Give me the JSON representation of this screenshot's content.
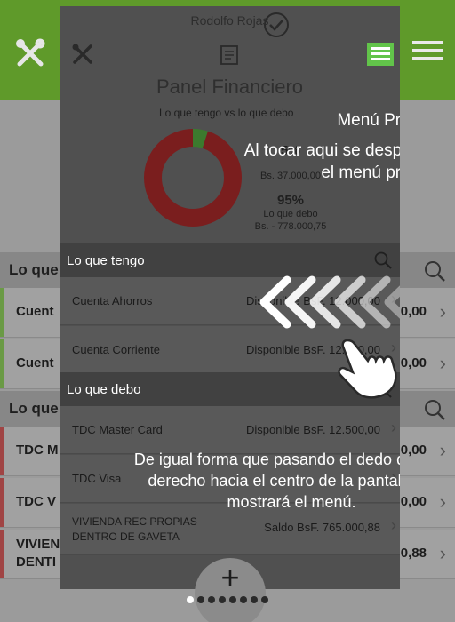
{
  "overlay": {
    "user_name": "Rodolfo Rojas",
    "title": "Panel Financiero",
    "chart_subtitle": "Lo que tengo vs lo que debo",
    "stat1_pct": "5%",
    "stat1_amount": "Bs. 37.000,00",
    "stat2_pct": "95%",
    "stat2_label": "Lo que debo",
    "stat2_amount": "Bs. - 778.000,75",
    "icons": [
      "tools-icon",
      "check-circle-icon",
      "document-icon",
      "menu-icon",
      "search-icon",
      "chevron-right-icon",
      "hand-pointer-icon"
    ],
    "accent_color": "#62c44a",
    "section_tengo": "Lo que tengo",
    "section_debo": "Lo que debo",
    "tengo_rows": [
      {
        "name": "Cuenta Ahorros",
        "avail": "Disponible BsF.  12.000,00"
      },
      {
        "name": "Cuenta Corriente",
        "avail": "Disponible BsF.  12.000,00"
      }
    ],
    "debo_rows": [
      {
        "name": "TDC Master Card",
        "avail": "Disponible BsF.  12.500,00"
      },
      {
        "name": "TDC Visa",
        "avail": ""
      },
      {
        "name_line1": "VIVIENDA REC PROPIAS",
        "name_line2": "DENTRO DE GAVETA",
        "avail": "Saldo BsF.  765.000,88"
      }
    ]
  },
  "tutorial": {
    "menu_title": "Menú Principal",
    "menu_body": "Al tocar aqui se desplegará el menú principal",
    "swipe_text": "De igual forma que pasando el dedo de lado derecho hacia el centro de la pantalla se mostrará el menú."
  },
  "chart_data": {
    "type": "pie",
    "title": "",
    "slices": [
      {
        "label": "Lo que tengo",
        "value": 5,
        "color": "#3c7a2e"
      },
      {
        "label": "Lo que debo",
        "value": 95,
        "color": "#7a1e1e"
      }
    ]
  },
  "background": {
    "section_tengo": "Lo que",
    "section_debo": "Lo que",
    "rows_tengo": [
      {
        "name": "Cuent",
        "amount": "0,00",
        "bar_color": "#6a9a45"
      },
      {
        "name": "Cuent",
        "amount": "0,00",
        "bar_color": "#6a9a45"
      }
    ],
    "rows_debo": [
      {
        "name": "TDC M",
        "amount": "0,00",
        "bar_color": "#a04444"
      },
      {
        "name": "TDC V",
        "amount": "0,00",
        "bar_color": "#a04444"
      },
      {
        "name": "VIVIEN",
        "name2": "DENTI",
        "amount": "0,88",
        "bar_color": "#a04444"
      }
    ]
  },
  "fab": {
    "label": "+"
  },
  "pager": {
    "count": 8,
    "active_index": 0
  }
}
